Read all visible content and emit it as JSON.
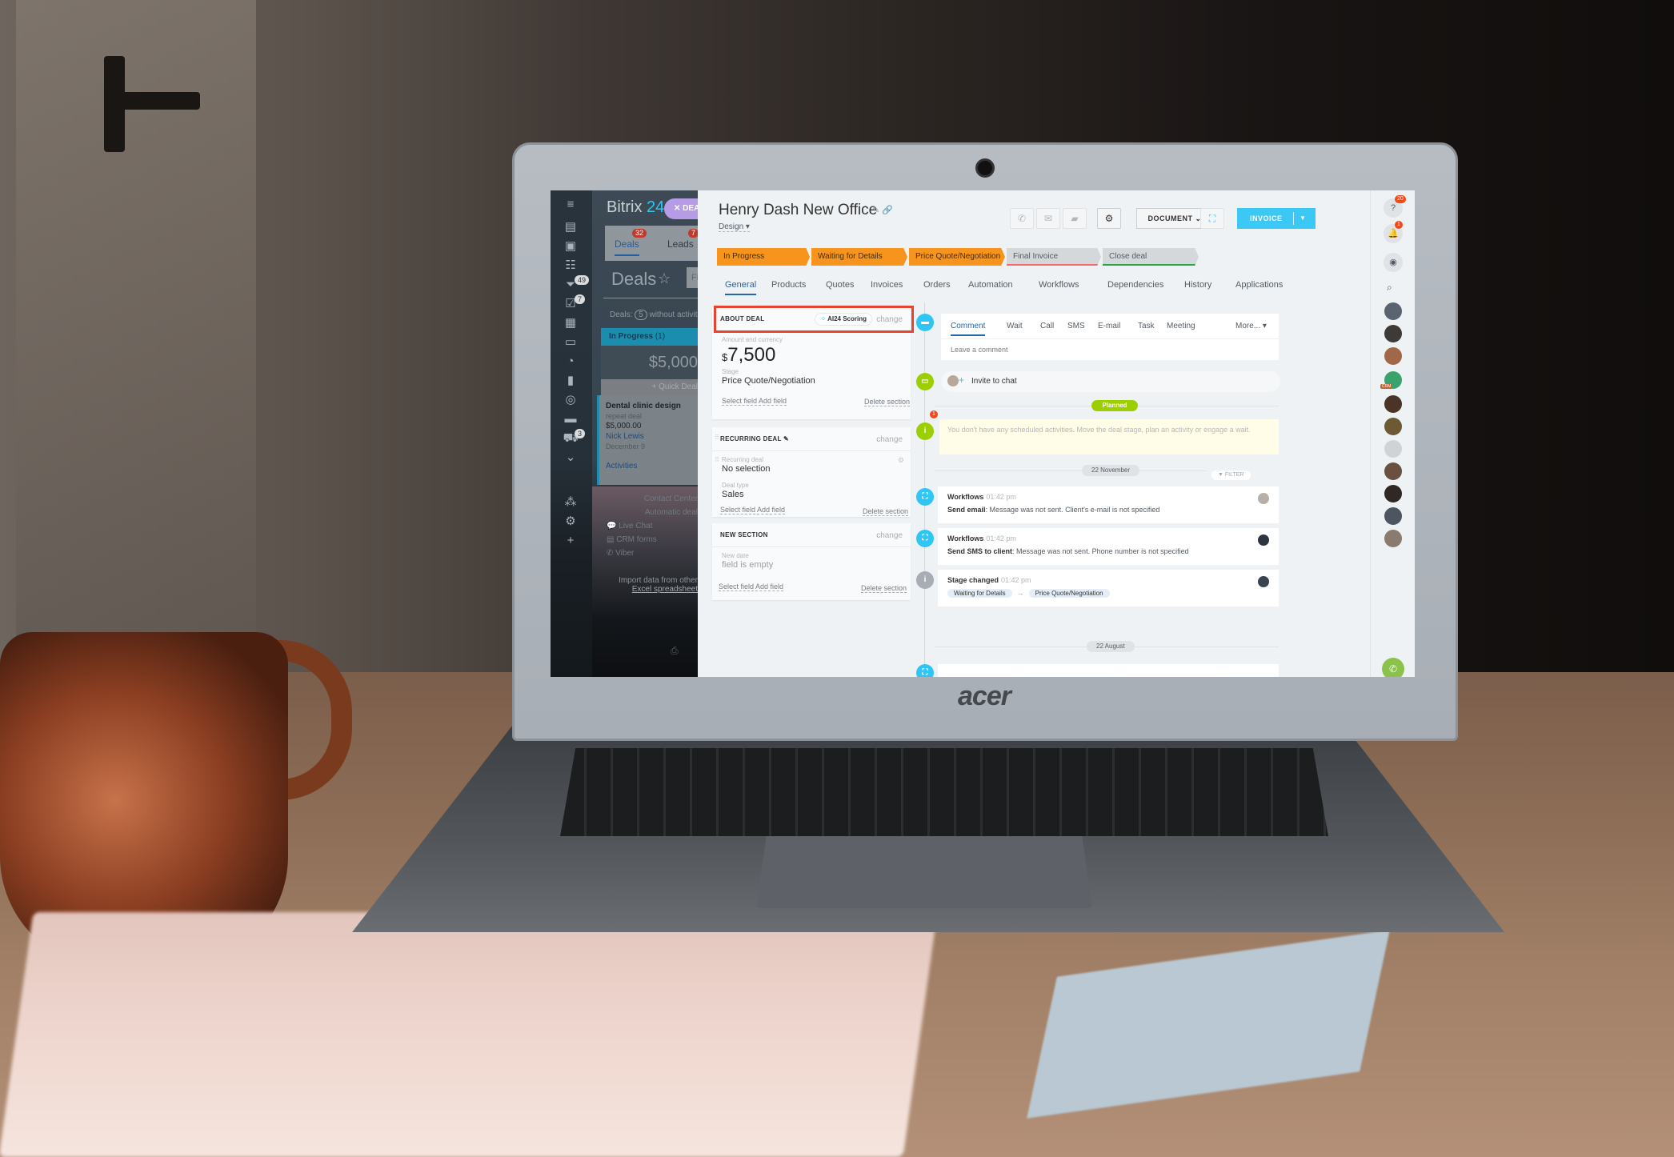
{
  "photo": {
    "laptop_brand": "acer"
  },
  "crm_panel": {
    "logo_text": "Bitrix",
    "logo_number": "24",
    "deal_chip_label": "DEAL",
    "tabs": [
      {
        "label": "Deals",
        "badge": "32"
      },
      {
        "label": "Leads",
        "badge": "7"
      }
    ],
    "nav_badges": {
      "funnel": "49",
      "tasks": "7",
      "cart": "3"
    },
    "deals_title": "Deals",
    "filter_placeholder": "Filter",
    "deals_count_prefix": "Deals:",
    "deals_count_value": "5",
    "deals_count_suffix": "without activities",
    "stage_column": {
      "name": "In Progress",
      "count": "(1)",
      "sum": "$5,000"
    },
    "quick_deal_label": "+ Quick Deal",
    "deal_card": {
      "title": "Dental clinic design",
      "subtitle": "repeat deal",
      "price": "$5,000.00",
      "contact": "Nick Lewis",
      "date": "December 9",
      "activities_link": "Activities"
    },
    "channels": {
      "contact_center": "Contact Center",
      "automatic_deal": "Automatic deal",
      "items": [
        "Live Chat",
        "CRM forms",
        "Viber"
      ]
    },
    "import_text": "Import data from other",
    "import_link": "Excel spreadsheet"
  },
  "deal": {
    "title": "Henry Dash New Office",
    "pipeline": "Design",
    "toolbar": {
      "document_label": "DOCUMENT",
      "invoice_label": "INVOICE"
    },
    "stages": [
      {
        "label": "In Progress",
        "state": "done"
      },
      {
        "label": "Waiting for Details",
        "state": "done"
      },
      {
        "label": "Price Quote/Negotiation",
        "state": "done"
      },
      {
        "label": "Final Invoice",
        "state": "fail"
      },
      {
        "label": "Close deal",
        "state": "win"
      }
    ],
    "tabs": [
      "General",
      "Products",
      "Quotes",
      "Invoices",
      "Orders",
      "Automation",
      "Workflows",
      "Dependencies",
      "History",
      "Applications"
    ],
    "active_tab": "General"
  },
  "about_deal": {
    "heading": "ABOUT DEAL",
    "ai_scoring_label": "AI24 Scoring",
    "change_label": "change",
    "amount_label": "Amount and currency",
    "amount_currency": "$",
    "amount_value": "7,500",
    "stage_label": "Stage",
    "stage_value": "Price Quote/Negotiation",
    "select_field": "Select field",
    "add_field": "Add field",
    "delete_section": "Delete section"
  },
  "recurring_deal": {
    "heading": "RECURRING DEAL",
    "change_label": "change",
    "recurring_label": "Recurring deal",
    "recurring_value": "No selection",
    "type_label": "Deal type",
    "type_value": "Sales",
    "select_field": "Select field",
    "add_field": "Add field",
    "delete_section": "Delete section"
  },
  "new_section": {
    "heading": "NEW SECTION",
    "change_label": "change",
    "date_label": "New date",
    "date_value": "field is empty",
    "select_field": "Select field",
    "add_field": "Add field",
    "delete_section": "Delete section"
  },
  "timeline": {
    "composer_tabs": [
      "Comment",
      "Wait",
      "Call",
      "SMS",
      "E-mail",
      "Task",
      "Meeting"
    ],
    "more_label": "More...",
    "comment_placeholder": "Leave a comment",
    "invite_label": "Invite to chat",
    "planned_label": "Planned",
    "planned_badge": "1",
    "notice": "You don't have any scheduled activities. Move the deal stage, plan an activity or engage a wait.",
    "date_1": "22 November",
    "filter_label": "FILTER",
    "events": [
      {
        "title": "Workflows",
        "time": "01:42 pm",
        "action": "Send email",
        "message": ": Message was not sent. Client's e-mail is not specified"
      },
      {
        "title": "Workflows",
        "time": "01:42 pm",
        "action": "Send SMS to client",
        "message": ": Message was not sent. Phone number is not specified"
      },
      {
        "title": "Stage changed",
        "time": "01:42 pm",
        "from": "Waiting for Details",
        "to": "Price Quote/Negotiation"
      }
    ],
    "date_2": "22 August"
  },
  "right_sidebar": {
    "help_badge": "20",
    "notifications_badge": "1",
    "crm_tag": "CRM"
  },
  "colors": {
    "accent_blue": "#2fc6f6",
    "stage_done": "#f7941d",
    "highlight_red": "#e8432f",
    "planned_green": "#9dcf00"
  }
}
